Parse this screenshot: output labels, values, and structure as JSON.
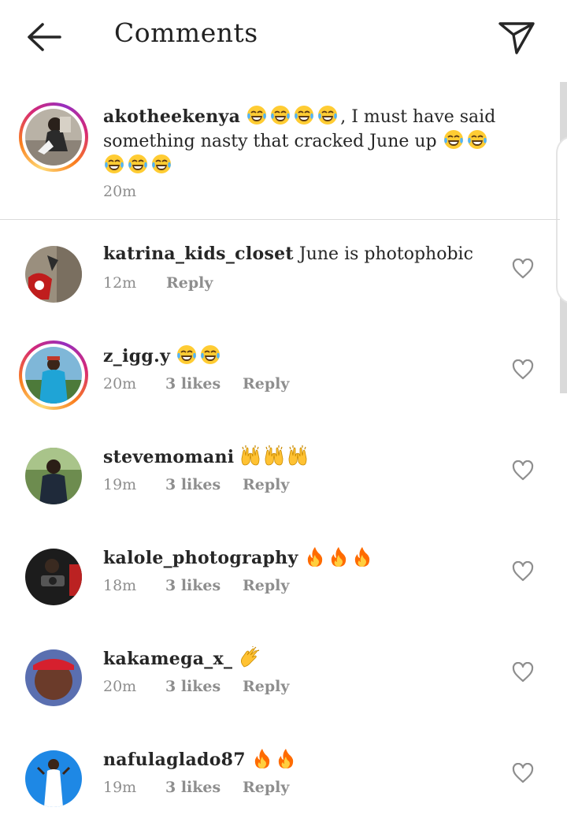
{
  "header": {
    "title": "Comments",
    "back_icon": "arrow-left-icon",
    "send_icon": "paper-plane-icon"
  },
  "caption": {
    "username": "akotheekenya",
    "text_part1": ", I must have said something nasty that cracked  June up ",
    "time": "20m"
  },
  "comments": [
    {
      "username": "katrina_kids_closet",
      "text": " June is photophobic",
      "time": "12m",
      "likes": "",
      "reply": "Reply",
      "emoji": []
    },
    {
      "username": "z_igg.y",
      "text": " ",
      "time": "20m",
      "likes": "3 likes",
      "reply": "Reply",
      "emoji": [
        "laughing-tears",
        "laughing-tears"
      ]
    },
    {
      "username": "stevemomani",
      "text": " ",
      "time": "19m",
      "likes": "3 likes",
      "reply": "Reply",
      "emoji": [
        "raising-hands",
        "raising-hands",
        "raising-hands"
      ]
    },
    {
      "username": "kalole_photography",
      "text": " ",
      "time": "18m",
      "likes": "3 likes",
      "reply": "Reply",
      "emoji": [
        "fire",
        "fire",
        "fire"
      ]
    },
    {
      "username": "kakamega_x_",
      "text": " ",
      "time": "20m",
      "likes": "3 likes",
      "reply": "Reply",
      "emoji": [
        "clapping-hands"
      ]
    },
    {
      "username": "nafulaglado87",
      "text": " ",
      "time": "19m",
      "likes": "3 likes",
      "reply": "Reply",
      "emoji": [
        "fire",
        "fire"
      ]
    }
  ],
  "colors": {
    "text": "#262626",
    "meta": "#8e8e8e",
    "divider": "#dbdbdb",
    "story_ring_start": "#feda75",
    "story_ring_end": "#962fbf"
  }
}
